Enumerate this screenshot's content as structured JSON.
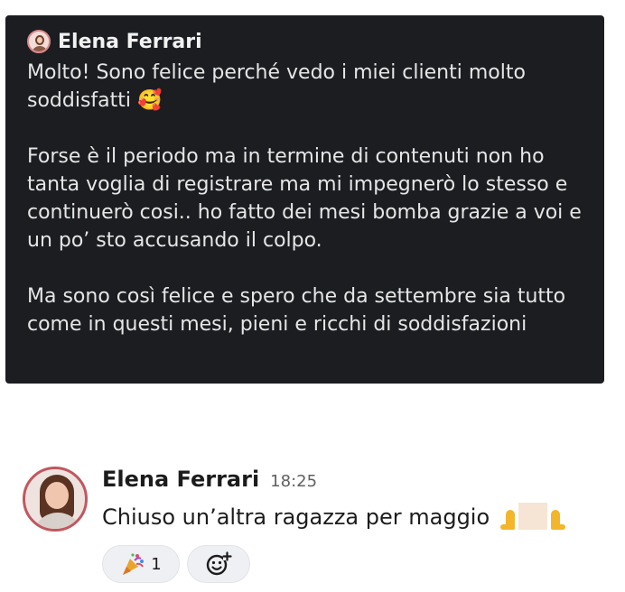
{
  "quoted_message": {
    "author": "Elena Ferrari",
    "paragraphs": [
      "Molto! Sono felice perché vedo i miei clienti molto soddisfatti 🥰",
      "Forse è il periodo ma in termine di contenuti non ho tanta voglia di registrare ma mi impegnerò lo stesso e continuerò cosi.. ho fatto dei mesi bomba grazie a voi e un po’ sto accusando il colpo.",
      "Ma sono così felice e spero che da settembre sia tutto come in questi mesi, pieni e ricchi di soddisfazioni"
    ]
  },
  "message": {
    "author": "Elena Ferrari",
    "time": "18:25",
    "text": "Chiuso un’altra ragazza per maggio",
    "reactions": [
      {
        "emoji": "tada-icon",
        "count": "1"
      },
      {
        "emoji": "add-reaction-icon"
      }
    ]
  },
  "colors": {
    "quote_bg": "#1b1d21",
    "avatar_ring": "#c0585f",
    "reaction_bg": "#eef0f3"
  }
}
